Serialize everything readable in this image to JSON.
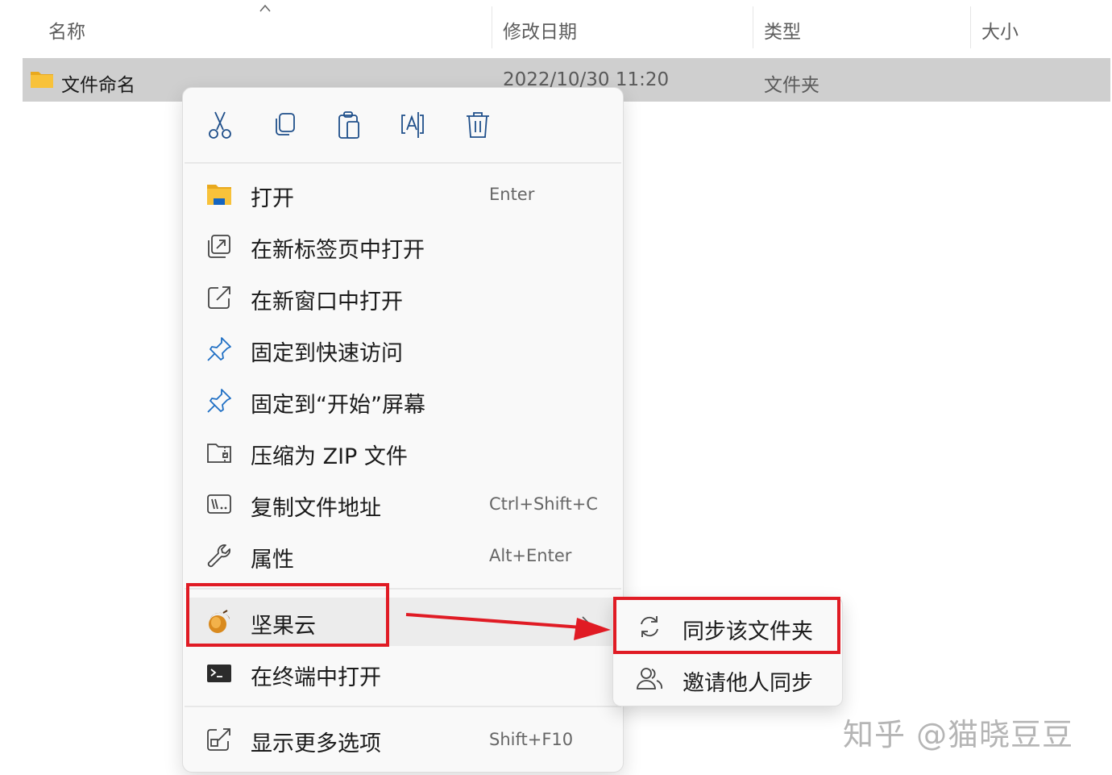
{
  "columns": {
    "name": "名称",
    "modified": "修改日期",
    "type": "类型",
    "size": "大小"
  },
  "file_row": {
    "name": "文件命名",
    "modified": "2022/10/30 11:20",
    "type": "文件夹"
  },
  "quick_actions": [
    "cut-icon",
    "copy-icon",
    "paste-icon",
    "rename-icon",
    "delete-icon"
  ],
  "menu": {
    "open": {
      "label": "打开",
      "shortcut": "Enter"
    },
    "open_new_tab": {
      "label": "在新标签页中打开"
    },
    "open_new_window": {
      "label": "在新窗口中打开"
    },
    "pin_quick_access": {
      "label": "固定到快速访问"
    },
    "pin_start": {
      "label": "固定到“开始”屏幕"
    },
    "compress_zip": {
      "label": "压缩为 ZIP 文件"
    },
    "copy_path": {
      "label": "复制文件地址",
      "shortcut": "Ctrl+Shift+C"
    },
    "properties": {
      "label": "属性",
      "shortcut": "Alt+Enter"
    },
    "jianguoyun": {
      "label": "坚果云"
    },
    "open_terminal": {
      "label": "在终端中打开"
    },
    "more_options": {
      "label": "显示更多选项",
      "shortcut": "Shift+F10"
    }
  },
  "submenu": {
    "sync_folder": {
      "label": "同步该文件夹"
    },
    "invite_sync": {
      "label": "邀请他人同步"
    }
  },
  "watermark": "知乎 @猫晓豆豆",
  "colors": {
    "highlight_red": "#e01b24",
    "accent_blue": "#1565c0",
    "folder_yellow": "#f8c23a"
  }
}
